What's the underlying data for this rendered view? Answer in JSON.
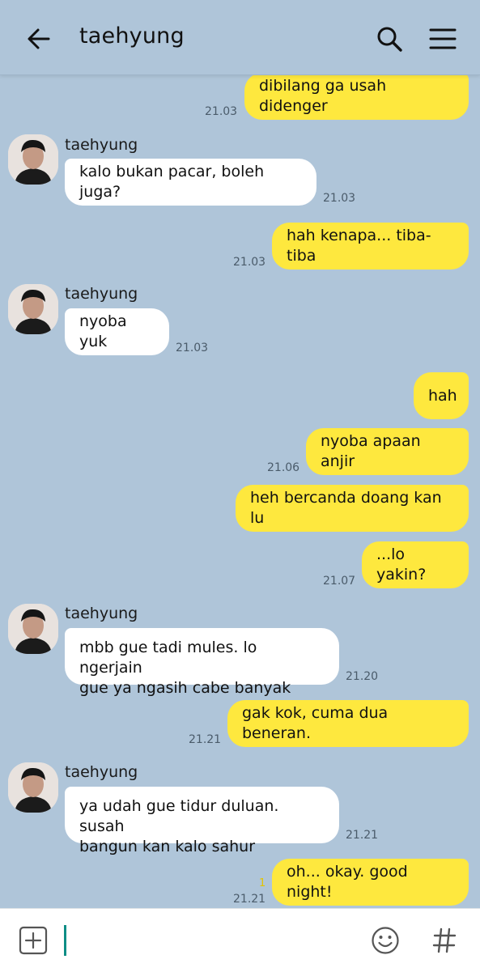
{
  "header": {
    "title": "taehyung"
  },
  "messages": [
    {
      "type": "out",
      "text": "dibilang ga usah didenger",
      "time": "21.03"
    },
    {
      "type": "in",
      "sender": "taehyung",
      "text": "kalo bukan pacar, boleh juga?",
      "time": "21.03"
    },
    {
      "type": "out",
      "text": "hah kenapa... tiba-tiba",
      "time": "21.03"
    },
    {
      "type": "in",
      "sender": "taehyung",
      "text": "nyoba yuk",
      "time": "21.03"
    },
    {
      "type": "out",
      "text": "hah",
      "time": ""
    },
    {
      "type": "out",
      "text": "nyoba apaan anjir",
      "time": "21.06"
    },
    {
      "type": "out",
      "text": "heh bercanda doang kan lu",
      "time": ""
    },
    {
      "type": "out",
      "text": "...lo yakin?",
      "time": "21.07"
    },
    {
      "type": "in",
      "sender": "taehyung",
      "text": "mbb gue tadi mules. lo ngerjain\ngue ya ngasih cabe banyak",
      "time": "21.20"
    },
    {
      "type": "out",
      "text": "gak kok, cuma dua beneran.",
      "time": "21.21"
    },
    {
      "type": "in",
      "sender": "taehyung",
      "text": "ya udah gue tidur duluan. susah\nbangun kan kalo sahur",
      "time": "21.21"
    },
    {
      "type": "out",
      "text": "oh... okay. good night!",
      "time": "21.21",
      "unread": "1"
    }
  ],
  "icons": {
    "back": "arrow-left-icon",
    "search": "search-icon",
    "menu": "hamburger-menu-icon",
    "attach": "plus-box-icon",
    "emoji": "smiley-icon",
    "hashtag": "hash-icon"
  },
  "colors": {
    "background": "#afc5d9",
    "outgoing_bubble": "#fee83e",
    "incoming_bubble": "#ffffff",
    "caret": "#0e8e86"
  }
}
